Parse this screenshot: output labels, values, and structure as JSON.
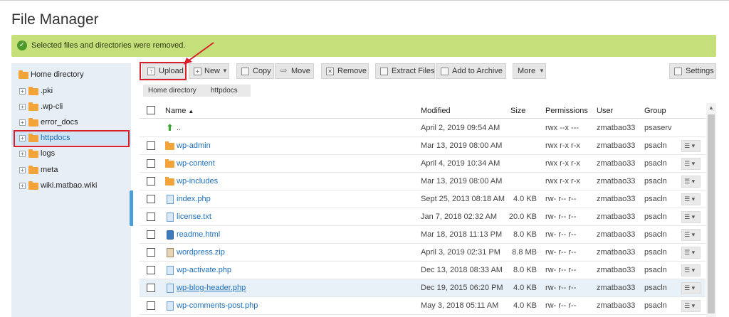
{
  "page": {
    "title": "File Manager"
  },
  "notice": {
    "message": "Selected files and directories were removed."
  },
  "sidebar": {
    "items": [
      {
        "label": "Home directory"
      },
      {
        "label": ".pki"
      },
      {
        "label": ".wp-cli"
      },
      {
        "label": "error_docs"
      },
      {
        "label": "httpdocs"
      },
      {
        "label": "logs"
      },
      {
        "label": "meta"
      },
      {
        "label": "wiki.matbao.wiki"
      }
    ]
  },
  "toolbar": {
    "upload": "Upload",
    "new": "New",
    "copy": "Copy",
    "move": "Move",
    "remove": "Remove",
    "extract": "Extract Files",
    "archive": "Add to Archive",
    "more": "More",
    "settings": "Settings"
  },
  "breadcrumb": [
    "Home directory",
    "httpdocs"
  ],
  "table": {
    "columns": {
      "name": "Name",
      "modified": "Modified",
      "size": "Size",
      "permissions": "Permissions",
      "user": "User",
      "group": "Group"
    },
    "rows": [
      {
        "name": "..",
        "modified": "April 2, 2019 09:54 AM",
        "size": "",
        "permissions": "rwx --x ---",
        "user": "zmatbao33",
        "group": "psaserv"
      },
      {
        "name": "wp-admin",
        "modified": "Mar 13, 2019 08:00 AM",
        "size": "",
        "permissions": "rwx r-x r-x",
        "user": "zmatbao33",
        "group": "psacln"
      },
      {
        "name": "wp-content",
        "modified": "April 4, 2019 10:34 AM",
        "size": "",
        "permissions": "rwx r-x r-x",
        "user": "zmatbao33",
        "group": "psacln"
      },
      {
        "name": "wp-includes",
        "modified": "Mar 13, 2019 08:00 AM",
        "size": "",
        "permissions": "rwx r-x r-x",
        "user": "zmatbao33",
        "group": "psacln"
      },
      {
        "name": "index.php",
        "modified": "Sept 25, 2013 08:18 AM",
        "size": "4.0 KB",
        "permissions": "rw- r-- r--",
        "user": "zmatbao33",
        "group": "psacln"
      },
      {
        "name": "license.txt",
        "modified": "Jan 7, 2018 02:32 AM",
        "size": "20.0 KB",
        "permissions": "rw- r-- r--",
        "user": "zmatbao33",
        "group": "psacln"
      },
      {
        "name": "readme.html",
        "modified": "Mar 18, 2018 11:13 PM",
        "size": "8.0 KB",
        "permissions": "rw- r-- r--",
        "user": "zmatbao33",
        "group": "psacln"
      },
      {
        "name": "wordpress.zip",
        "modified": "April 3, 2019 02:31 PM",
        "size": "8.8 MB",
        "permissions": "rw- r-- r--",
        "user": "zmatbao33",
        "group": "psacln"
      },
      {
        "name": "wp-activate.php",
        "modified": "Dec 13, 2018 08:33 AM",
        "size": "8.0 KB",
        "permissions": "rw- r-- r--",
        "user": "zmatbao33",
        "group": "psacln"
      },
      {
        "name": "wp-blog-header.php",
        "modified": "Dec 19, 2015 06:20 PM",
        "size": "4.0 KB",
        "permissions": "rw- r-- r--",
        "user": "zmatbao33",
        "group": "psacln"
      },
      {
        "name": "wp-comments-post.php",
        "modified": "May 3, 2018 05:11 AM",
        "size": "4.0 KB",
        "permissions": "rw- r-- r--",
        "user": "zmatbao33",
        "group": "psacln"
      }
    ]
  }
}
